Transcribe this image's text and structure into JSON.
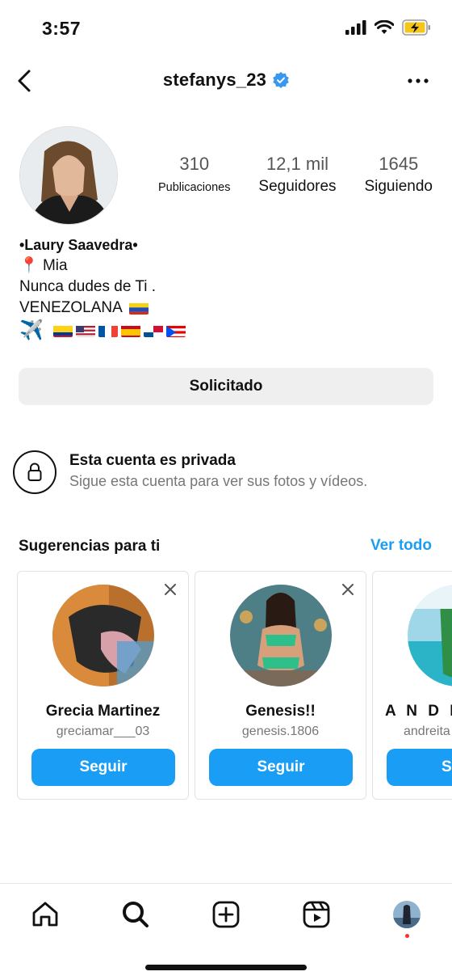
{
  "status_bar": {
    "time": "3:57"
  },
  "header": {
    "username": "stefanys_23",
    "verified": true
  },
  "profile": {
    "stats": [
      {
        "value": "310",
        "label": "Publicaciones"
      },
      {
        "value": "12,1 mil",
        "label": "Seguidores"
      },
      {
        "value": "1645",
        "label": "Siguiendo"
      }
    ],
    "bio": {
      "name": "•Laury Saavedra•",
      "location_pin": "📍",
      "location": "Mia",
      "line2": "Nunca dudes de Ti .",
      "line3": "VENEZOLANA",
      "plane": "✈️"
    },
    "request_button": "Solicitado"
  },
  "private_account": {
    "title": "Esta cuenta es privada",
    "subtitle": "Sigue esta cuenta para ver sus fotos y vídeos."
  },
  "suggestions": {
    "title": "Sugerencias para ti",
    "see_all": "Ver todo",
    "cards": [
      {
        "name": "Grecia Martinez",
        "username": "greciamar___03",
        "button": "Seguir"
      },
      {
        "name": "Genesis!!",
        "username": "genesis.1806",
        "button": "Seguir"
      },
      {
        "name": "A N D R E",
        "username": "andreita",
        "button": "Se"
      }
    ]
  },
  "colors": {
    "accent": "#1a9ef5",
    "verified": "#3897f0",
    "button_gray": "#efefef"
  },
  "tab_bar": {
    "icons": [
      "home-icon",
      "search-icon",
      "create-icon",
      "reels-icon",
      "profile-avatar"
    ]
  }
}
